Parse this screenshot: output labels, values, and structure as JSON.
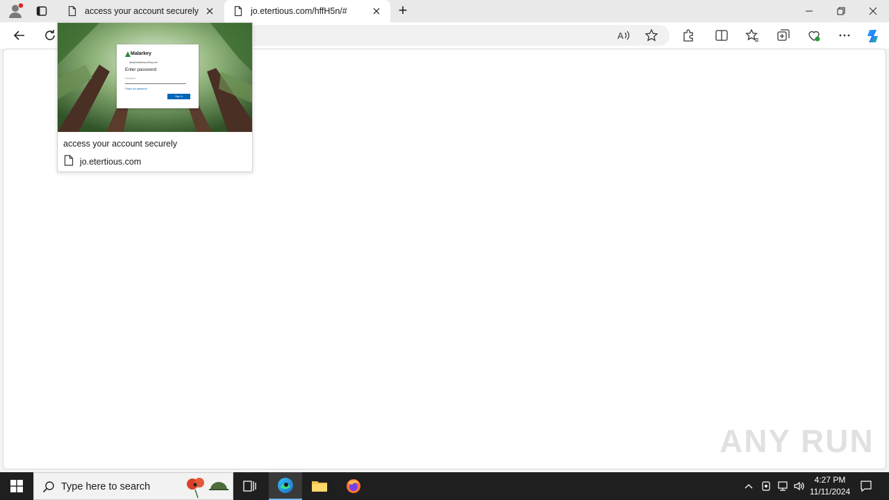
{
  "browser": {
    "tabs": [
      {
        "title": "access your account securely",
        "active": false
      },
      {
        "title": "jo.etertious.com/hffH5n/#",
        "active": true
      }
    ],
    "new_tab_symbol": "+"
  },
  "hover_card": {
    "title": "access your account securely",
    "url": "jo.etertious.com",
    "thumbnail": {
      "brand": "Malarkey",
      "email": "lisa@malarkeyroofing.com",
      "heading": "Enter password",
      "password_placeholder": "Password",
      "forgot_link": "Forgot my password",
      "sign_in_label": "Sign in"
    }
  },
  "watermark": "ANY RUN",
  "taskbar": {
    "search_placeholder": "Type here to search",
    "time": "4:27 PM",
    "date": "11/11/2024"
  },
  "colors": {
    "accent": "#0067b8",
    "taskbar": "#1f1f1f",
    "tabstrip": "#e9e9e9"
  }
}
